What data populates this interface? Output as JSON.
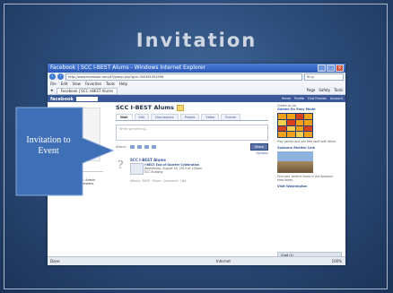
{
  "slide": {
    "title": "Invitation"
  },
  "browser": {
    "window_title": "Facebook | SCC I-BEST Alums - Windows Internet Explorer",
    "url": "http://www.facebook.com/#!/group.php?gid=300391952596",
    "search_placeholder": "Bing",
    "menu": [
      "File",
      "Edit",
      "View",
      "Favorites",
      "Tools",
      "Help"
    ],
    "tab_label": "Facebook | SCC I-BEST Alums",
    "tools": [
      "Page",
      "Safety",
      "Tools"
    ],
    "status_left": "Done",
    "status_zone": "Internet",
    "zoom": "100%"
  },
  "facebook": {
    "logo": "facebook",
    "top_links": [
      "Home",
      "Profile",
      "Find Friends",
      "Account"
    ],
    "group_name": "SCC I-BEST Alums",
    "tabs": [
      "Wall",
      "Info",
      "Discussions",
      "Photos",
      "Video",
      "Events"
    ],
    "composer_placeholder": "Write something...",
    "attach_label": "Attach:",
    "share_button": "Share",
    "filters_link": "Options",
    "left_link": "Create an Event",
    "left_box_title": "Information",
    "left_box_text": "Privacy Type: Closed: Admin must approve all members",
    "story": {
      "author": "SCC I-BEST Alums",
      "event_title": "I-BEST End of Quarter Celebration",
      "event_when": "Wednesday, August 18, 2010 at 1:00pm",
      "event_where": "SCC Building ",
      "meta": "Attend · RSVP · Share · Comment · Like"
    },
    "right_col": {
      "create_link": "Create an Ad",
      "ad_title": "Games On Easy Mode",
      "ad_text": "Play games and win free stuff with Wikia.",
      "ad2_title": "Spokane Realtor Link",
      "ad2_text": "Find your perfect home in the Spokane area today.",
      "ad3_title": "Visit Washington",
      "chat_label": "Chat (1)"
    }
  },
  "callout": {
    "text": "Invitation to Event"
  },
  "colors": {
    "slide_bg": "#2d4e7c",
    "fb_blue": "#3b5998",
    "callout_fill": "#3e6fb7"
  }
}
